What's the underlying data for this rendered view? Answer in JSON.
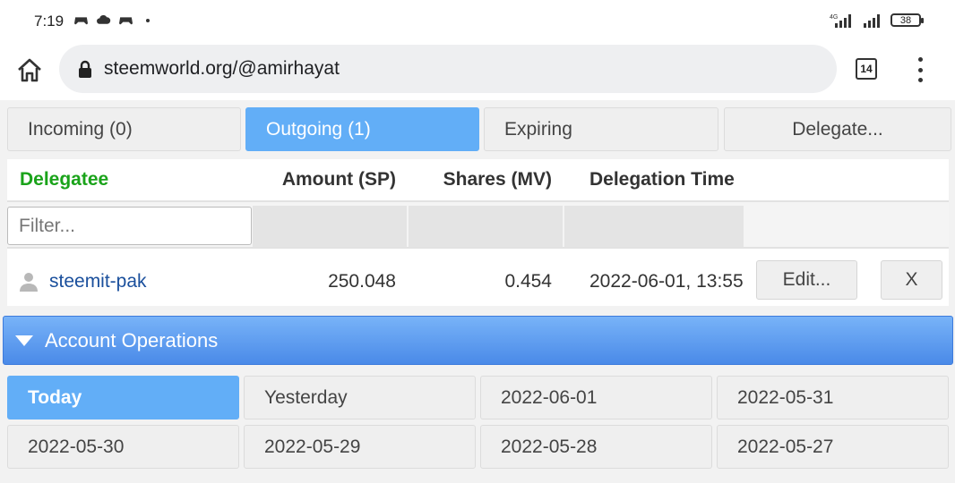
{
  "status_bar": {
    "time": "7:19",
    "network": "4G",
    "battery": "38"
  },
  "browser": {
    "url": "steemworld.org/@amirhayat",
    "tab_count": "14"
  },
  "delegation_tabs": [
    {
      "label": "Incoming (0)",
      "active": false
    },
    {
      "label": "Outgoing (1)",
      "active": true
    },
    {
      "label": "Expiring",
      "active": false
    },
    {
      "label": "Delegate...",
      "active": false
    }
  ],
  "table": {
    "columns": [
      "Delegatee",
      "Amount (SP)",
      "Shares (MV)",
      "Delegation Time"
    ],
    "filter_placeholder": "Filter...",
    "rows": [
      {
        "delegatee": "steemit-pak",
        "amount_sp": "250.048",
        "shares_mv": "0.454",
        "delegation_time": "2022-06-01, 13:55",
        "edit_label": "Edit...",
        "remove_label": "X"
      }
    ]
  },
  "account_operations": {
    "title": "Account Operations",
    "days": [
      {
        "label": "Today",
        "active": true
      },
      {
        "label": "Yesterday",
        "active": false
      },
      {
        "label": "2022-06-01",
        "active": false
      },
      {
        "label": "2022-05-31",
        "active": false
      },
      {
        "label": "2022-05-30",
        "active": false
      },
      {
        "label": "2022-05-29",
        "active": false
      },
      {
        "label": "2022-05-28",
        "active": false
      },
      {
        "label": "2022-05-27",
        "active": false
      }
    ]
  },
  "colors": {
    "accent_blue": "#62aef7",
    "header_green": "#1aa31a",
    "link_blue": "#1a4f9c"
  }
}
